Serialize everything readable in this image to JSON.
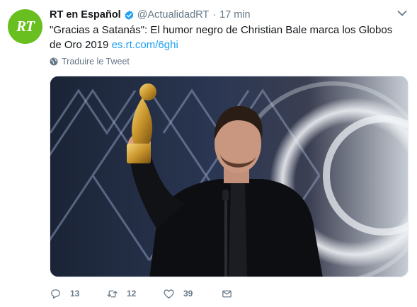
{
  "tweet": {
    "author_name": "RT en Español",
    "handle": "@ActualidadRT",
    "separator": "·",
    "time": "17 min",
    "avatar_text": "RT",
    "text": "\"Gracias a Satanás\": El humor negro de Christian Bale marca los Globos de Oro 2019",
    "link": "es.rt.com/6ghi",
    "translate_label": "Traduire le Tweet"
  },
  "actions": {
    "replies": "13",
    "retweets": "12",
    "likes": "39"
  },
  "colors": {
    "avatar": "#6abf20",
    "link": "#1da1f2",
    "verified": "#1da1f2",
    "muted": "#657786"
  },
  "icons": [
    "verified-badge-icon",
    "chevron-down-icon",
    "globe-icon",
    "reply-icon",
    "retweet-icon",
    "like-icon",
    "direct-message-icon"
  ]
}
